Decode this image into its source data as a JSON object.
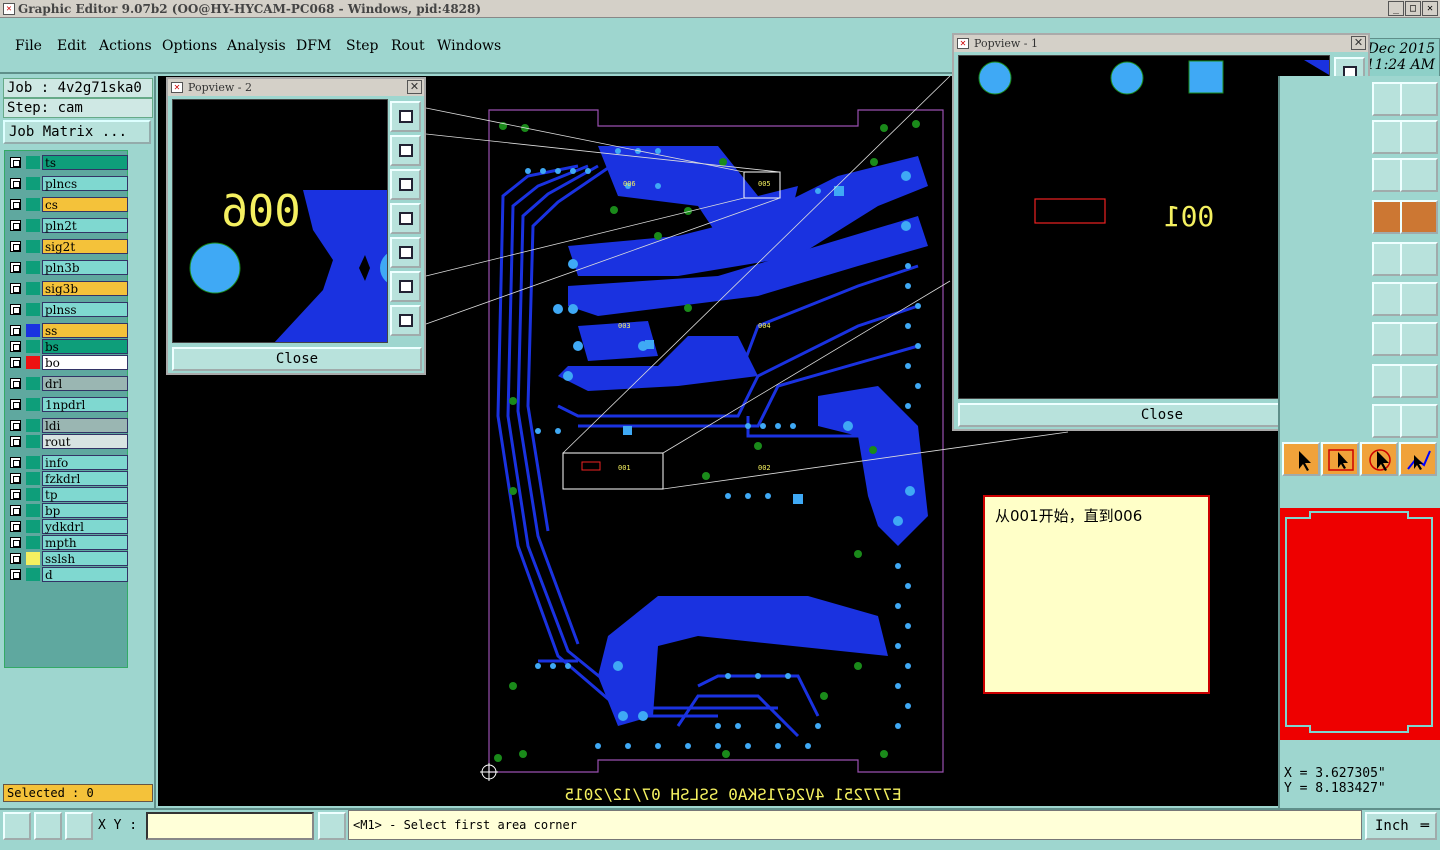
{
  "window": {
    "title": "Graphic Editor 9.07b2 (OO@HY-HYCAM-PC068 - Windows, pid:4828)",
    "clock_line1": "Genesis 2000  27 Dec 2015",
    "clock_line2": "11:24 AM"
  },
  "menu": [
    "File",
    "Edit",
    "Actions",
    "Options",
    "Analysis",
    "DFM",
    "Step",
    "Rout",
    "Windows"
  ],
  "job": {
    "name": "Job : 4v2g71ska0",
    "step": "Step: cam",
    "matrix_button": "Job Matrix ..."
  },
  "layers": [
    {
      "name": "ts",
      "color": "#0e9e7a",
      "swatch": "#0e9e7a"
    },
    {
      "name": "plncs",
      "color": "#7fd8d0",
      "swatch": "#0e9e7a"
    },
    {
      "name": "cs",
      "color": "#f4c23a",
      "swatch": "#0e9e7a"
    },
    {
      "name": "pln2t",
      "color": "#7fd8d0",
      "swatch": "#0e9e7a"
    },
    {
      "name": "sig2t",
      "color": "#f4c23a",
      "swatch": "#0e9e7a"
    },
    {
      "name": "pln3b",
      "color": "#7fd8d0",
      "swatch": "#0e9e7a"
    },
    {
      "name": "sig3b",
      "color": "#f4c23a",
      "swatch": "#0e9e7a"
    },
    {
      "name": "plnss",
      "color": "#7fd8d0",
      "swatch": "#0e9e7a"
    },
    {
      "name": "ss",
      "color": "#f4c23a",
      "swatch": "#1a32e0"
    },
    {
      "name": "bs",
      "color": "#0e9e7a",
      "swatch": "#0e9e7a"
    },
    {
      "name": "bo",
      "color": "#ffffff",
      "swatch": "#ee1111"
    },
    {
      "name": "drl",
      "color": "#9ab6b2",
      "swatch": "#0e9e7a"
    },
    {
      "name": "1npdrl",
      "color": "#7fd8d0",
      "swatch": "#0e9e7a"
    },
    {
      "name": "ldi",
      "color": "#9ab6b2",
      "swatch": "#0e9e7a"
    },
    {
      "name": "rout",
      "color": "#d8e4e2",
      "swatch": "#0e9e7a"
    },
    {
      "name": "info",
      "color": "#7fd8d0",
      "swatch": "#0e9e7a"
    },
    {
      "name": "fzkdrl",
      "color": "#7fd8d0",
      "swatch": "#0e9e7a"
    },
    {
      "name": "tp",
      "color": "#7fd8d0",
      "swatch": "#0e9e7a"
    },
    {
      "name": "bp",
      "color": "#7fd8d0",
      "swatch": "#0e9e7a"
    },
    {
      "name": "ydkdrl",
      "color": "#7fd8d0",
      "swatch": "#0e9e7a"
    },
    {
      "name": "mpth",
      "color": "#7fd8d0",
      "swatch": "#0e9e7a"
    },
    {
      "name": "sslsh",
      "color": "#7fd8d0",
      "swatch": "#f4f060"
    },
    {
      "name": "d",
      "color": "#7fd8d0",
      "swatch": "#0e9e7a"
    }
  ],
  "selected": "Selected : 0",
  "popview2": {
    "title": "Popview - 2",
    "close": "Close",
    "label": "006"
  },
  "popview1": {
    "title": "Popview - 1",
    "close": "Close",
    "label": "001"
  },
  "board": {
    "bottom_text": "E777251 4V2G71SKA0 SSLSH 07/12/2015",
    "labels": [
      "006",
      "005",
      "004",
      "003",
      "002",
      "001"
    ]
  },
  "note": "从001开始，直到006",
  "coords": {
    "x": "X =  3.627305\"",
    "y": "Y =  8.183427\""
  },
  "bottom": {
    "xy_label": "X Y :",
    "xy_value": "",
    "status": "<M1> - Select first area corner",
    "units": "Inch"
  },
  "colors": {
    "panel": "#9ed6cf",
    "trace": "#1a32e0",
    "pad": "#3fa9f5",
    "via": "#1a8a1a",
    "silk": "#f4f060"
  }
}
